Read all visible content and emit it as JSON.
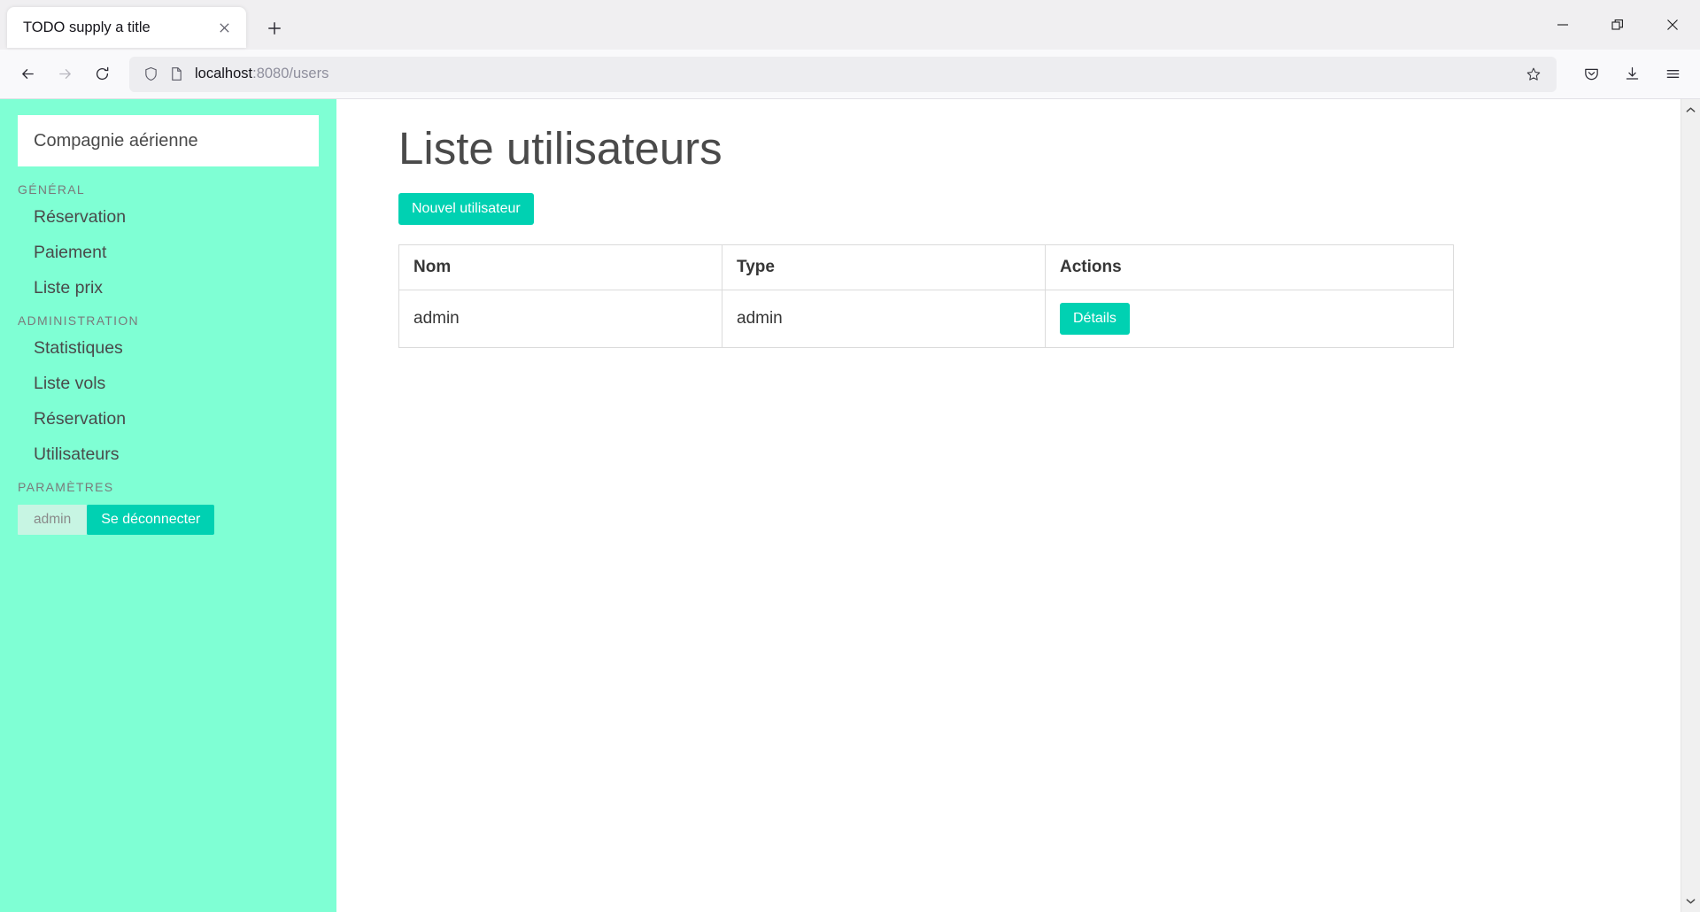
{
  "browser": {
    "tab": {
      "title": "TODO supply a title",
      "close_icon": "close-icon"
    },
    "new_tab_icon": "plus-icon",
    "window_controls": {
      "minimize": "minimize-icon",
      "restore": "restore-icon",
      "close": "close-icon"
    },
    "nav": {
      "back": "back-arrow-icon",
      "forward": "forward-arrow-icon",
      "reload": "reload-icon"
    },
    "url": {
      "host": "localhost",
      "rest": ":8080/users",
      "full": "localhost:8080/users",
      "shield_icon": "shield-icon",
      "page_icon": "page-icon"
    },
    "bookmark_icon": "star-icon",
    "toolbar_right": {
      "pocket": "pocket-icon",
      "downloads": "download-icon",
      "menu": "hamburger-menu-icon"
    }
  },
  "sidebar": {
    "brand": "Compagnie aérienne",
    "sections": [
      {
        "label": "GÉNÉRAL",
        "items": [
          {
            "label": "Réservation"
          },
          {
            "label": "Paiement"
          },
          {
            "label": "Liste prix"
          }
        ]
      },
      {
        "label": "ADMINISTRATION",
        "items": [
          {
            "label": "Statistiques"
          },
          {
            "label": "Liste vols"
          },
          {
            "label": "Réservation"
          },
          {
            "label": "Utilisateurs"
          }
        ]
      }
    ],
    "settings_label": "PARAMÈTRES",
    "current_user": "admin",
    "logout_label": "Se déconnecter"
  },
  "main": {
    "title": "Liste utilisateurs",
    "new_user_label": "Nouvel utilisateur",
    "table": {
      "columns": [
        "Nom",
        "Type",
        "Actions"
      ],
      "rows": [
        {
          "nom": "admin",
          "type": "admin",
          "action_label": "Détails"
        }
      ]
    }
  },
  "scrollbar": {
    "up": "chevron-up-icon",
    "down": "chevron-down-icon"
  },
  "colors": {
    "sidebar_bg": "#7fffd4",
    "primary": "#00d1b2",
    "tag_bg": "#c7f5e3",
    "text": "#4a4a4a"
  }
}
